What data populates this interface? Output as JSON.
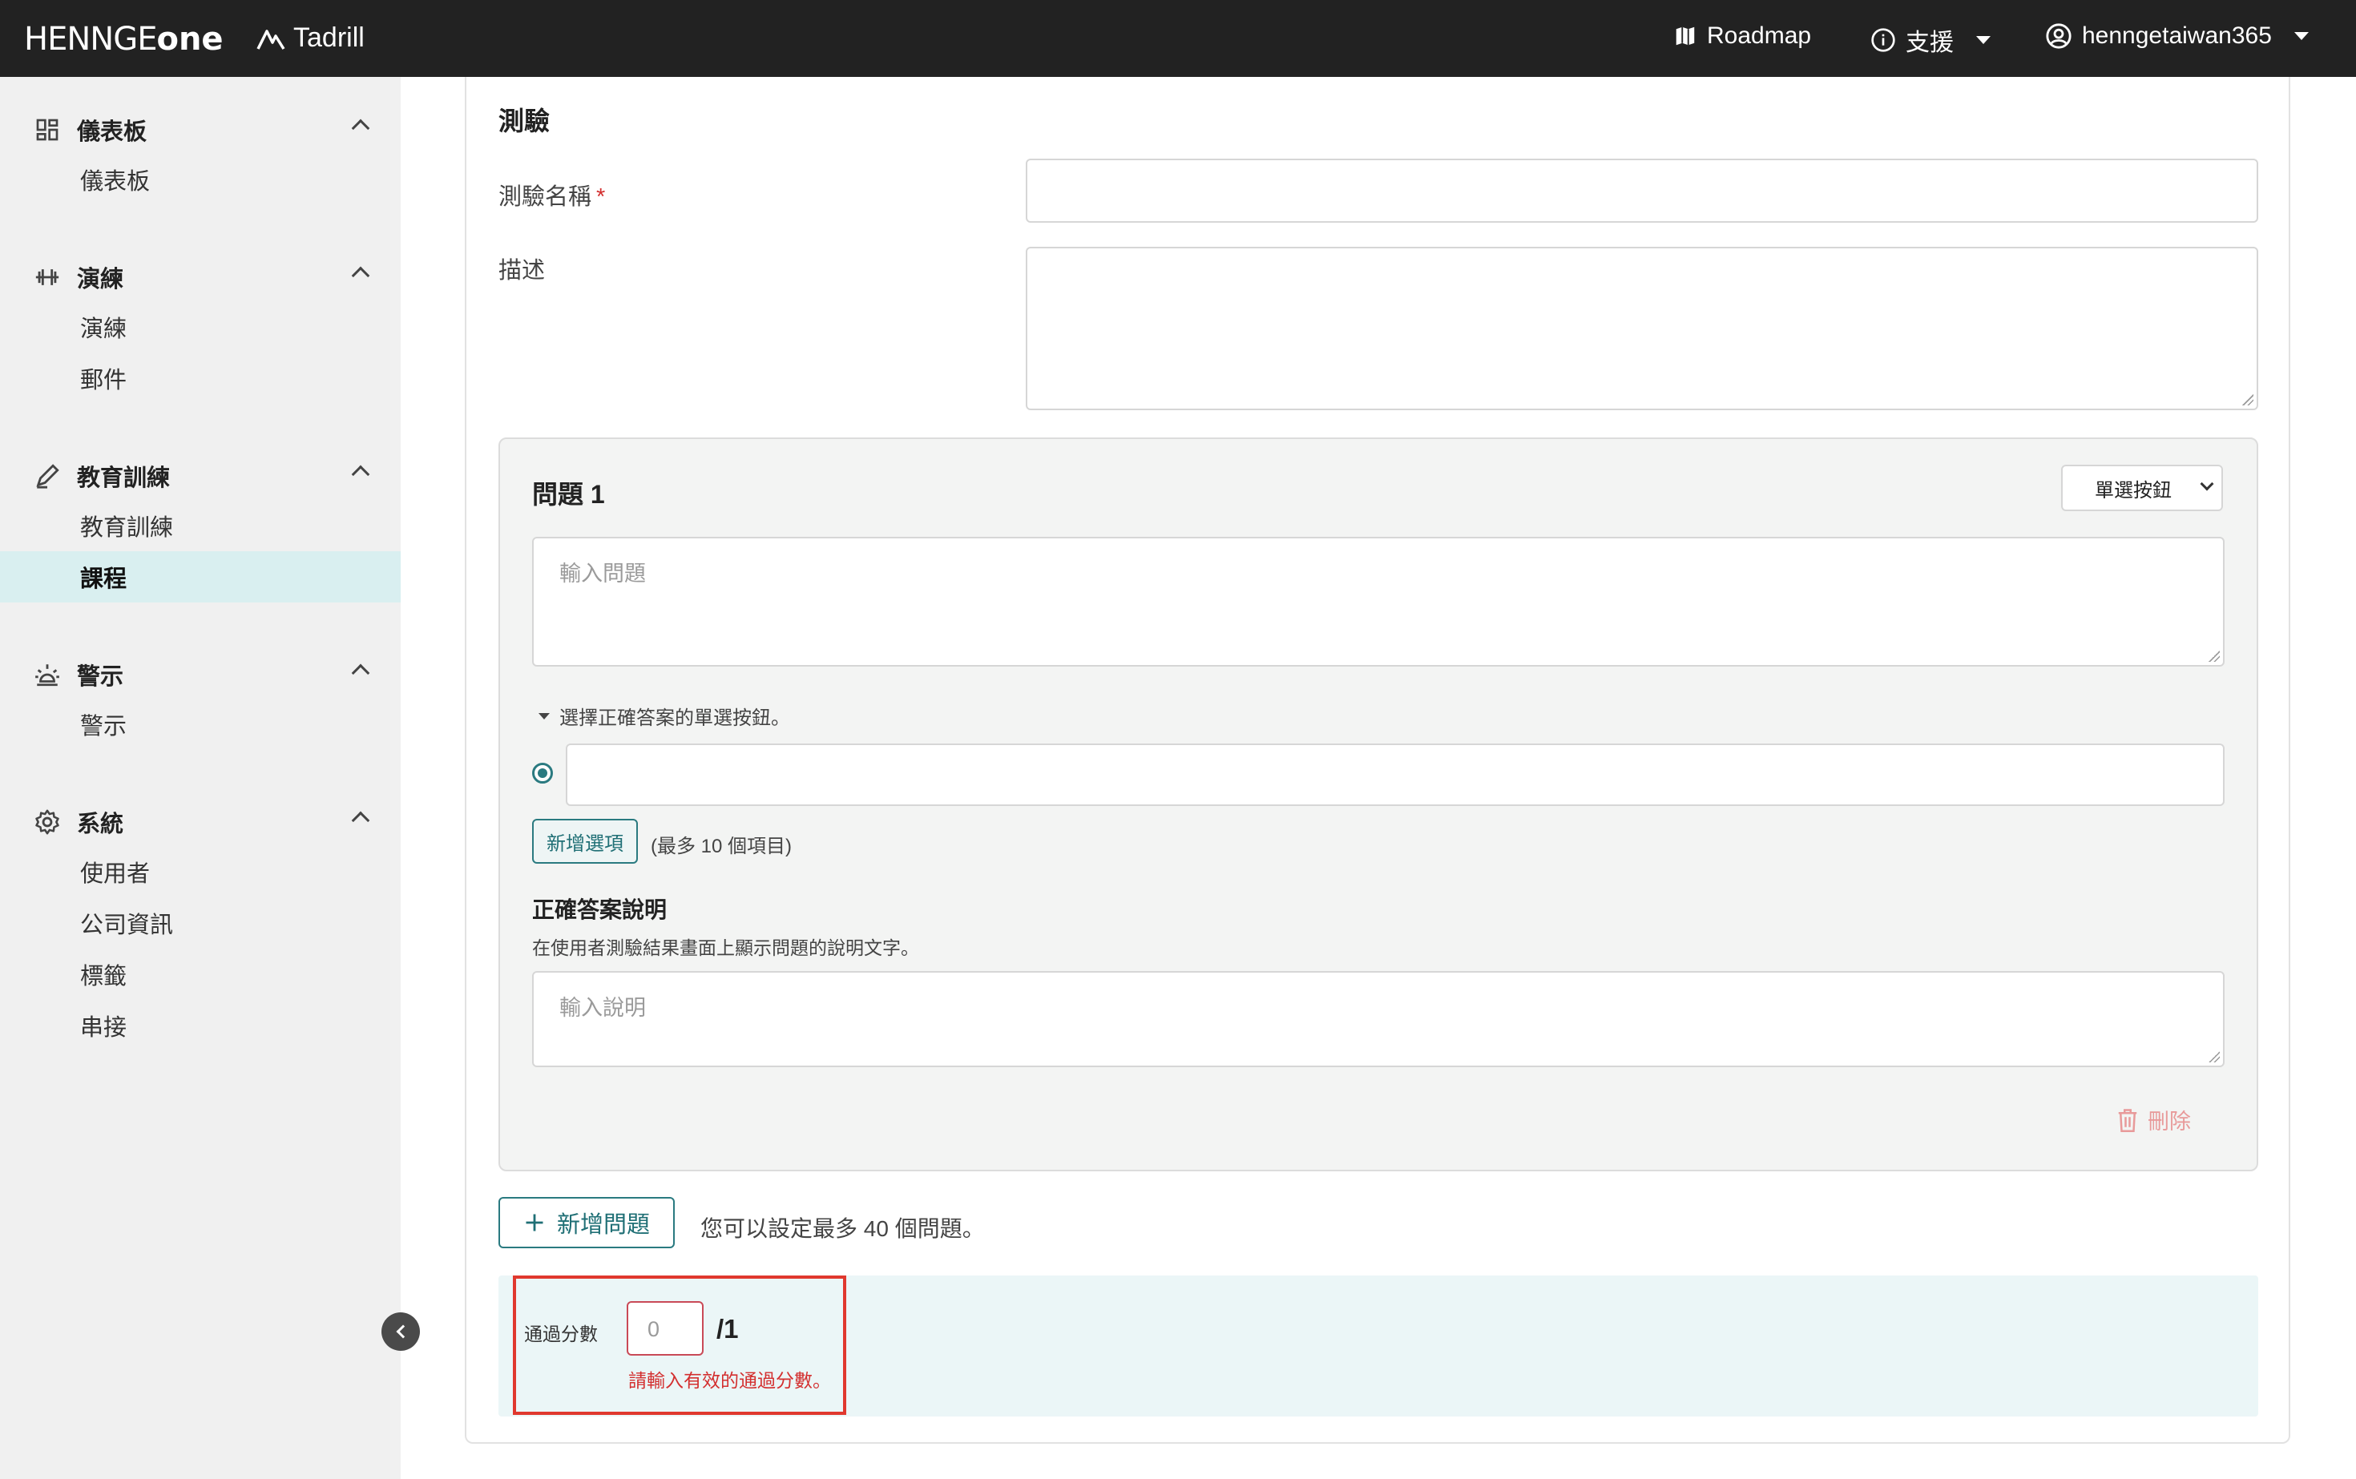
{
  "header": {
    "logo": "HENNGE",
    "logo_one": "one",
    "product": "Tadrill",
    "roadmap": "Roadmap",
    "support": "支援",
    "user": "henngetaiwan365"
  },
  "sidebar": {
    "groups": [
      {
        "label": "儀表板",
        "icon": "dashboard-icon",
        "items": [
          "儀表板"
        ]
      },
      {
        "label": "演練",
        "icon": "dumbbell-icon",
        "items": [
          "演練",
          "郵件"
        ]
      },
      {
        "label": "教育訓練",
        "icon": "pen-icon",
        "items": [
          "教育訓練",
          "課程"
        ]
      },
      {
        "label": "警示",
        "icon": "alarm-light-icon",
        "items": [
          "警示"
        ]
      },
      {
        "label": "系統",
        "icon": "gear-icon",
        "items": [
          "使用者",
          "公司資訊",
          "標籤",
          "串接"
        ]
      }
    ],
    "active_item": "課程"
  },
  "form": {
    "section_title": "測驗",
    "name_label": "測驗名稱",
    "name_required": "*",
    "name_value": "",
    "desc_label": "描述",
    "desc_value": ""
  },
  "question": {
    "title": "問題 1",
    "type_select": "單選按鈕",
    "question_placeholder": "輸入問題",
    "option_hint": "選擇正確答案的單選按鈕。",
    "option_value": "",
    "add_option_label": "新增選項",
    "add_option_note": "(最多 10 個項目)",
    "explanation_title": "正確答案說明",
    "explanation_desc": "在使用者測驗結果畫面上顯示問題的說明文字。",
    "explanation_placeholder": "輸入說明",
    "delete_label": "刪除"
  },
  "add_question": {
    "label": "新增問題",
    "note": "您可以設定最多 40 個問題。"
  },
  "pass_score": {
    "label": "通過分數",
    "placeholder": "0",
    "total": "/1",
    "error": "請輸入有效的通過分數。"
  },
  "colors": {
    "topbar": "#222222",
    "accent": "#2a7a80",
    "error": "#d32f2f",
    "active_bg": "#d9eff0"
  }
}
